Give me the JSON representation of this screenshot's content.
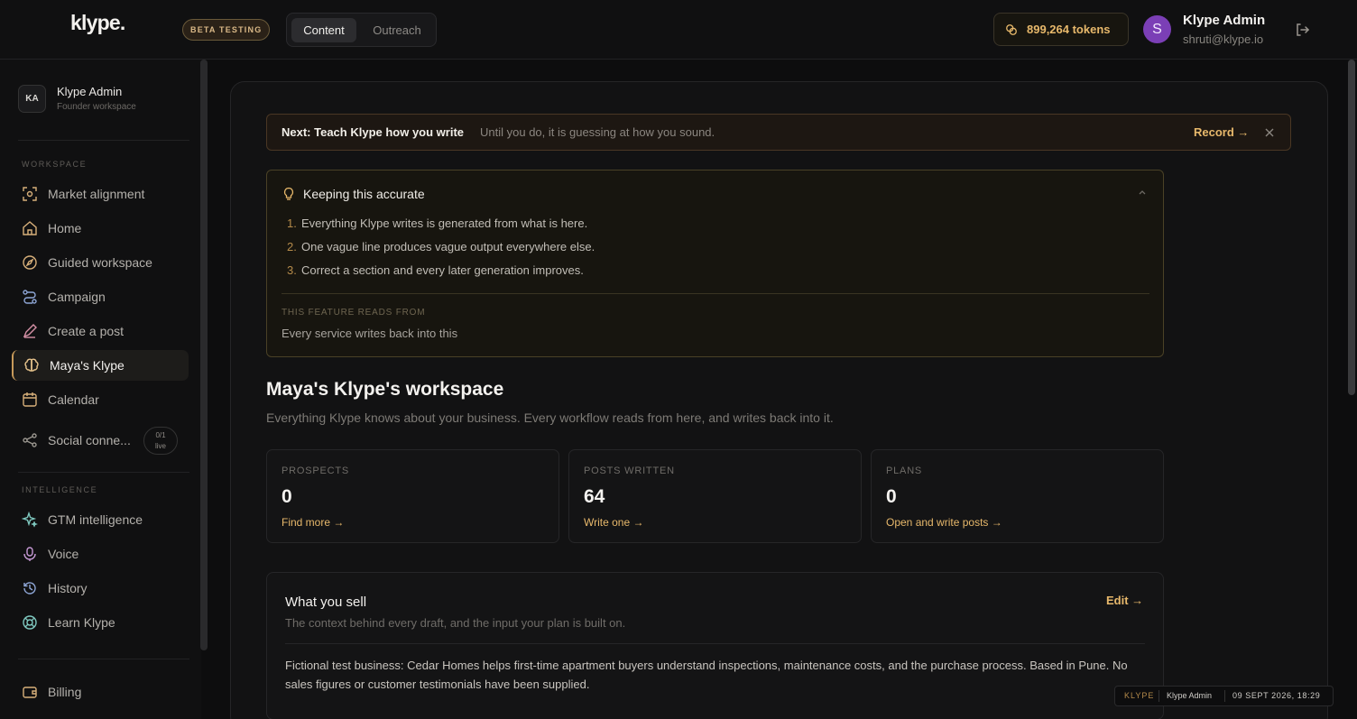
{
  "app": {
    "logo": "klype."
  },
  "header": {
    "beta_badge": "BETA TESTING",
    "modes": [
      "Content",
      "Outreach"
    ],
    "tokens": "899,264 tokens",
    "avatar_initial": "S",
    "user_name": "Klype Admin",
    "user_email": "shruti@klype.io"
  },
  "sidebar": {
    "workspace": {
      "initials": "KA",
      "name": "Klype Admin",
      "subtitle": "Founder workspace"
    },
    "sections": {
      "workspace": "WORKSPACE",
      "intelligence": "INTELLIGENCE"
    },
    "workspace_items": [
      {
        "label": "Market alignment",
        "icon": "target-scan-icon"
      },
      {
        "label": "Home",
        "icon": "home-icon"
      },
      {
        "label": "Guided workspace",
        "icon": "compass-icon"
      },
      {
        "label": "Campaign",
        "icon": "route-icon"
      },
      {
        "label": "Create a post",
        "icon": "pen-icon"
      },
      {
        "label": "Maya's Klype",
        "icon": "brain-icon",
        "active": true
      },
      {
        "label": "Calendar",
        "icon": "calendar-icon"
      },
      {
        "label": "Social conne...",
        "icon": "share-icon",
        "badge_top": "0/1",
        "badge_bottom": "live"
      }
    ],
    "intelligence_items": [
      {
        "label": "GTM intelligence",
        "icon": "sparkles-icon"
      },
      {
        "label": "Voice",
        "icon": "microphone-icon"
      },
      {
        "label": "History",
        "icon": "history-icon"
      },
      {
        "label": "Learn Klype",
        "icon": "lifebuoy-icon"
      }
    ],
    "bottom_items": [
      {
        "label": "Billing",
        "icon": "wallet-icon"
      }
    ]
  },
  "banner": {
    "title": "Next: Teach Klype how you write",
    "subtitle": "Until you do, it is guessing at how you sound.",
    "action": "Record →"
  },
  "accuracy": {
    "title": "Keeping this accurate",
    "items": [
      {
        "n": "1.",
        "text": "Everything Klype writes is generated from what is here."
      },
      {
        "n": "2.",
        "text": "One vague line produces vague output everywhere else."
      },
      {
        "n": "3.",
        "text": "Correct a section and every later generation improves."
      }
    ],
    "reads_label": "THIS FEATURE READS FROM",
    "reads_value": "Every service writes back into this"
  },
  "workspace": {
    "title": "Maya's Klype's workspace",
    "description": "Everything Klype knows about your business. Every workflow reads from here, and writes back into it."
  },
  "stats": [
    {
      "label": "PROSPECTS",
      "value": "0",
      "link": "Find more →"
    },
    {
      "label": "POSTS WRITTEN",
      "value": "64",
      "link": "Write one →"
    },
    {
      "label": "PLANS",
      "value": "0",
      "link": "Open and write posts →"
    }
  ],
  "sell": {
    "title": "What you sell",
    "subtitle": "The context behind every draft, and the input your plan is built on.",
    "edit": "Edit →",
    "body": "Fictional test business: Cedar Homes helps first-time apartment buyers understand inspections, maintenance costs, and the purchase process. Based in Pune. No sales figures or customer testimonials have been supplied."
  },
  "footer": {
    "brand": "KLYPE",
    "user": "Klype Admin",
    "datetime": "09 SEPT 2026, 18:29"
  },
  "colors": {
    "accent": "#e7b86b",
    "background": "#0d0d0e",
    "avatar": "#7b3fb6"
  }
}
